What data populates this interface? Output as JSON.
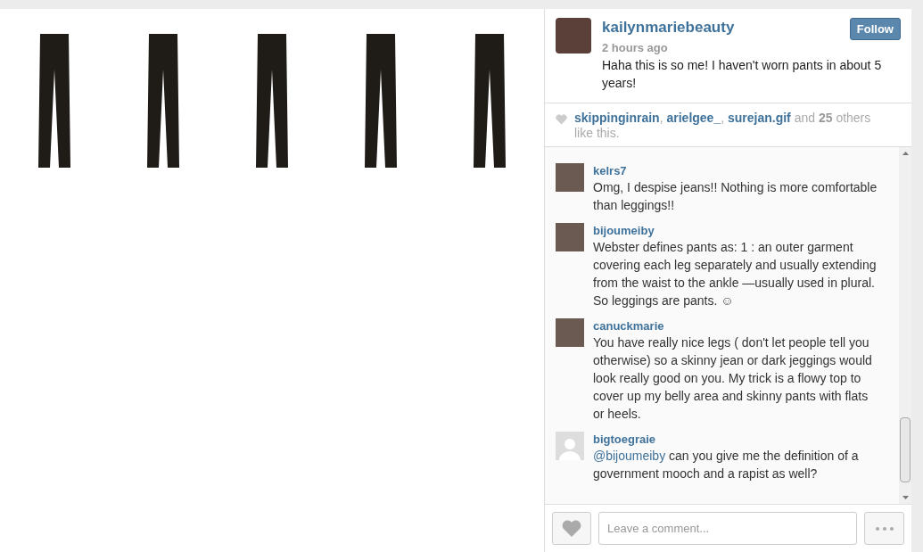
{
  "post": {
    "image": {
      "kind": "graphic"
    },
    "author": {
      "username": "kailynmariebeauty",
      "time": "2 hours ago",
      "caption": "Haha this is so me! I haven't worn pants in about 5 years!"
    },
    "follow_button": "Follow",
    "likes": {
      "users": [
        "skippinginrain",
        "arielgee_",
        "surejan.gif"
      ],
      "separator": ",",
      "and": "and",
      "count": "25",
      "rest": "others like this."
    },
    "comments": [
      {
        "username": "kelrs7",
        "kind": "photo",
        "text": "Omg, I despise jeans!! Nothing is more comfortable than leggings!!"
      },
      {
        "username": "bijoumeiby",
        "kind": "photo",
        "text": "Webster defines pants as: 1 : an outer garment covering each leg separately and usually extending from the waist to the ankle —usually used in plural. So leggings are pants. ☺"
      },
      {
        "username": "canuckmarie",
        "kind": "photo",
        "text": "You have really nice legs ( don't let people tell you otherwise) so a skinny jean or dark jeggings would look really good on you. My trick is a flowy top to cover up my belly area and skinny pants with flats or heels."
      },
      {
        "username": "bigtoegraie",
        "kind": "default",
        "mention": "@bijoumeiby",
        "text": "can you give me the definition of a government mooch and a rapist as well?"
      }
    ],
    "comment_field": {
      "placeholder": "Leave a comment..."
    }
  }
}
